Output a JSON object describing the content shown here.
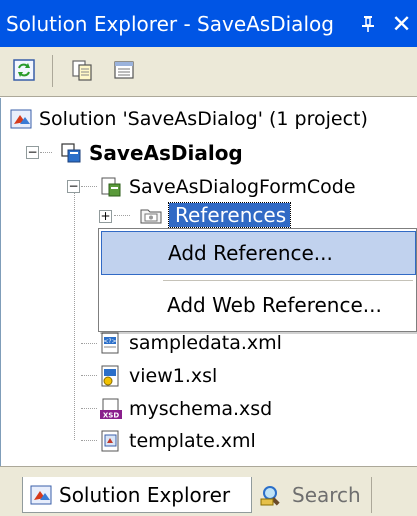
{
  "window": {
    "title": "Solution Explorer - SaveAsDialog",
    "pin_glyph": "ᛡ",
    "close_glyph": "✕"
  },
  "toolbar": {
    "buttons": [
      {
        "icon": "refresh-icon"
      },
      {
        "icon": "copy-icon"
      },
      {
        "icon": "properties-icon"
      }
    ]
  },
  "tree": {
    "solution": "Solution 'SaveAsDialog' (1 project)",
    "project": "SaveAsDialog",
    "form_code": "SaveAsDialogFormCode",
    "references": "References",
    "files": [
      "sampledata.xml",
      "view1.xsl",
      "myschema.xsd",
      "template.xml"
    ]
  },
  "context_menu": {
    "items": [
      {
        "label": "Add Reference..."
      },
      {
        "label": "Add Web Reference..."
      }
    ]
  },
  "tabs": {
    "solution_explorer": "Solution Explorer",
    "search": "Search"
  },
  "colors": {
    "title_bar": "#0055e5",
    "selection": "#316ac5",
    "menu_hover": "#c1d2ee",
    "chrome": "#ece9d8"
  }
}
